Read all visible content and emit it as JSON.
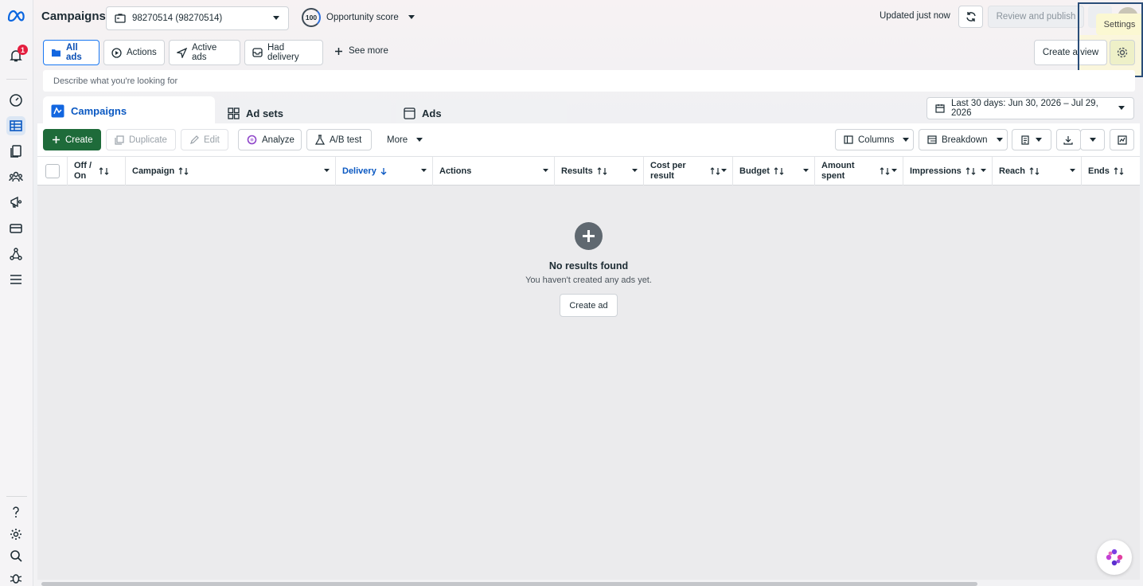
{
  "app": {
    "page_title": "Campaigns",
    "account_selector": "98270514 (98270514)",
    "opportunity_score_value": "100",
    "opportunity_score_label": "Opportunity score",
    "updated_text": "Updated just now",
    "review_publish_label": "Review and publish",
    "tooltip_text": "Settings"
  },
  "rail": {
    "notification_count": "1"
  },
  "filters": {
    "chips": [
      "All ads",
      "Actions",
      "Active ads",
      "Had delivery"
    ],
    "see_more": "See more",
    "create_view": "Create a view",
    "search_placeholder": "Describe what you're looking for"
  },
  "tabs": [
    "Campaigns",
    "Ad sets",
    "Ads"
  ],
  "date_range": "Last 30 days: Jun 30, 2026 – Jul 29, 2026",
  "toolbar": {
    "create": "Create",
    "duplicate": "Duplicate",
    "edit": "Edit",
    "analyze": "Analyze",
    "ab_test": "A/B test",
    "more": "More",
    "columns": "Columns",
    "breakdown": "Breakdown"
  },
  "columns": {
    "off_on_1": "Off /",
    "off_on_2": "On",
    "campaign": "Campaign",
    "delivery": "Delivery",
    "actions": "Actions",
    "results": "Results",
    "cost_1": "Cost per",
    "cost_2": "result",
    "budget": "Budget",
    "amount_1": "Amount",
    "amount_2": "spent",
    "impressions": "Impressions",
    "reach": "Reach",
    "ends": "Ends"
  },
  "empty_state": {
    "title": "No results found",
    "subtitle": "You haven't created any ads yet.",
    "button": "Create ad"
  },
  "colors": {
    "accent_blue": "#0a58c2",
    "create_green": "#1e6b3a",
    "badge_red": "#e41e3f"
  }
}
